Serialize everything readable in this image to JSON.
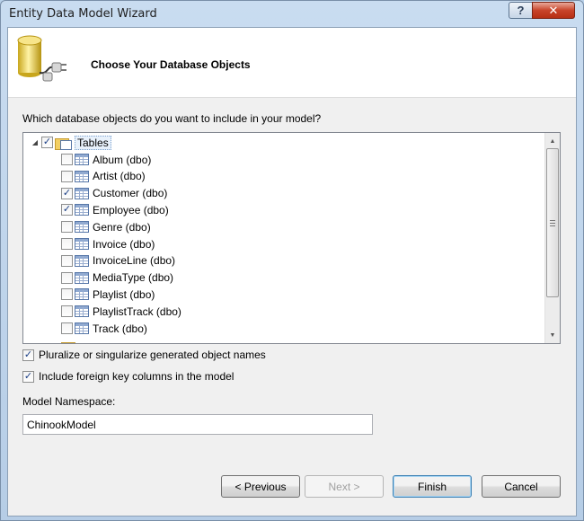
{
  "window": {
    "title": "Entity Data Model Wizard"
  },
  "titlebar": {
    "help_label": "?",
    "close_label": "✕"
  },
  "header": {
    "title": "Choose Your Database Objects"
  },
  "objects": {
    "question": "Which database objects do you want to include in your model?",
    "root": {
      "label": "Tables",
      "checked": true,
      "expanded": true
    },
    "tables": [
      {
        "label": "Album (dbo)",
        "checked": false
      },
      {
        "label": "Artist (dbo)",
        "checked": false
      },
      {
        "label": "Customer (dbo)",
        "checked": true
      },
      {
        "label": "Employee (dbo)",
        "checked": true
      },
      {
        "label": "Genre (dbo)",
        "checked": false
      },
      {
        "label": "Invoice (dbo)",
        "checked": false
      },
      {
        "label": "InvoiceLine (dbo)",
        "checked": false
      },
      {
        "label": "MediaType (dbo)",
        "checked": false
      },
      {
        "label": "Playlist (dbo)",
        "checked": false
      },
      {
        "label": "PlaylistTrack (dbo)",
        "checked": false
      },
      {
        "label": "Track (dbo)",
        "checked": false
      }
    ]
  },
  "options": {
    "pluralize": {
      "label": "Pluralize or singularize generated object names",
      "checked": true
    },
    "foreign_keys": {
      "label": "Include foreign key columns in the model",
      "checked": true
    }
  },
  "namespace": {
    "label": "Model Namespace:",
    "value": "ChinookModel"
  },
  "buttons": {
    "previous": "< Previous",
    "next": "Next >",
    "finish": "Finish",
    "cancel": "Cancel"
  },
  "check_glyph": "✓"
}
